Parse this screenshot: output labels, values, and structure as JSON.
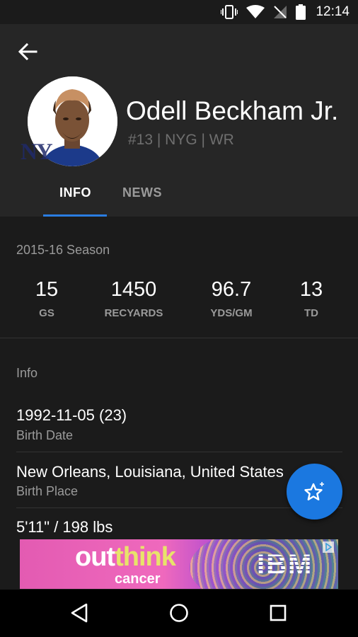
{
  "status_bar": {
    "time": "12:14"
  },
  "player": {
    "name": "Odell Beckham Jr.",
    "meta": "#13 | NYG | WR",
    "team_logo": "NY"
  },
  "tabs": [
    {
      "label": "INFO",
      "active": true
    },
    {
      "label": "NEWS",
      "active": false
    }
  ],
  "season": {
    "title": "2015-16 Season",
    "stats": [
      {
        "value": "15",
        "label": "GS"
      },
      {
        "value": "1450",
        "label": "RECYARDS"
      },
      {
        "value": "96.7",
        "label": "YDS/GM"
      },
      {
        "value": "13",
        "label": "TD"
      }
    ]
  },
  "info": {
    "title": "Info",
    "rows": [
      {
        "value": "1992-11-05 (23)",
        "label": "Birth Date"
      },
      {
        "value": "New Orleans, Louisiana, United States",
        "label": "Birth Place"
      },
      {
        "value": "5'11\" / 198 lbs",
        "label": ""
      }
    ]
  },
  "ad": {
    "text_out": "out",
    "text_think": "think",
    "subtext": "cancer",
    "brand": "IBM"
  },
  "colors": {
    "accent": "#1b78e0",
    "tab_indicator": "#2a7de1",
    "background": "#1b1b1b",
    "header": "#262626"
  },
  "icons": {
    "back": "arrow-left-icon",
    "fab": "star-add-icon",
    "nav": [
      "back-triangle-icon",
      "home-circle-icon",
      "recents-square-icon"
    ]
  }
}
